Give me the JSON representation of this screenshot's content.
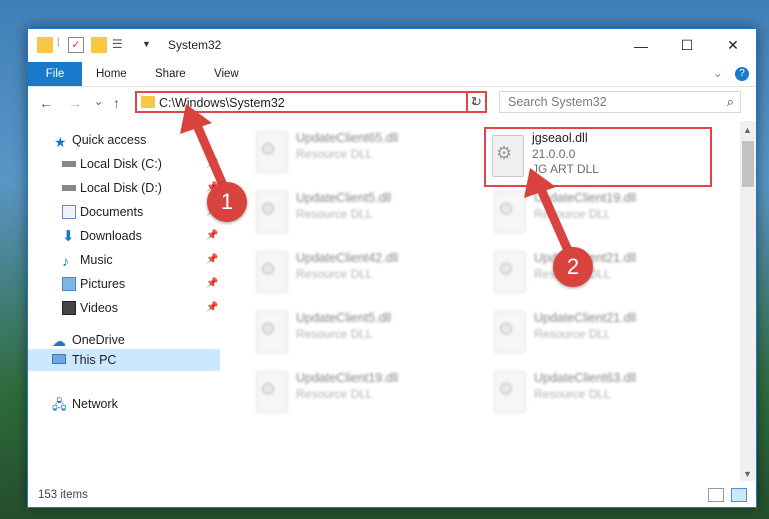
{
  "window": {
    "title": "System32",
    "controls": {
      "minimize": "—",
      "maximize": "☐",
      "close": "✕"
    }
  },
  "ribbon": {
    "tabs": [
      "File",
      "Home",
      "Share",
      "View"
    ],
    "help": "?",
    "expand": "⌄"
  },
  "nav": {
    "back": "←",
    "forward": "→",
    "recent": "⌄",
    "up": "↑",
    "address": "C:\\Windows\\System32",
    "address_dropdown": "⌄",
    "refresh": "↻",
    "search_placeholder": "Search System32"
  },
  "sidebar": {
    "items": [
      {
        "label": "Quick access",
        "icon": "star-icon"
      },
      {
        "label": "Local Disk (C:)",
        "icon": "drive-icon"
      },
      {
        "label": "Local Disk (D:)",
        "icon": "drive-icon"
      },
      {
        "label": "Documents",
        "icon": "documents-icon"
      },
      {
        "label": "Downloads",
        "icon": "download-icon"
      },
      {
        "label": "Music",
        "icon": "music-icon"
      },
      {
        "label": "Pictures",
        "icon": "pictures-icon"
      },
      {
        "label": "Videos",
        "icon": "videos-icon"
      },
      {
        "label": "OneDrive",
        "icon": "cloud-icon"
      },
      {
        "label": "This PC",
        "icon": "computer-icon"
      },
      {
        "label": "Network",
        "icon": "network-icon"
      }
    ]
  },
  "files": {
    "highlighted": {
      "name": "jgseaol.dll",
      "version": "21.0.0.0",
      "description": "JG ART DLL"
    },
    "left_column": [
      {
        "name": "UpdateClient65.dll",
        "type": "Resource DLL"
      },
      {
        "name": "UpdateClient5.dll",
        "type": "Resource DLL"
      },
      {
        "name": "UpdateClient42.dll",
        "type": "Resource DLL"
      },
      {
        "name": "UpdateClient5.dll",
        "type": "Resource DLL"
      },
      {
        "name": "UpdateClient19.dll",
        "type": "Resource DLL"
      }
    ],
    "right_column": [
      {
        "name": "UpdateClient19.dll",
        "type": "Resource DLL"
      },
      {
        "name": "UpdateClient21.dll",
        "type": "Resource DLL"
      },
      {
        "name": "UpdateClient21.dll",
        "type": "Resource DLL"
      },
      {
        "name": "UpdateClient63.dll",
        "type": "Resource DLL"
      }
    ]
  },
  "status": {
    "item_count": "153 items"
  },
  "callouts": {
    "one": "1",
    "two": "2"
  },
  "colors": {
    "accent": "#1979ca",
    "highlight": "#e04646",
    "selection": "#cce8ff"
  }
}
